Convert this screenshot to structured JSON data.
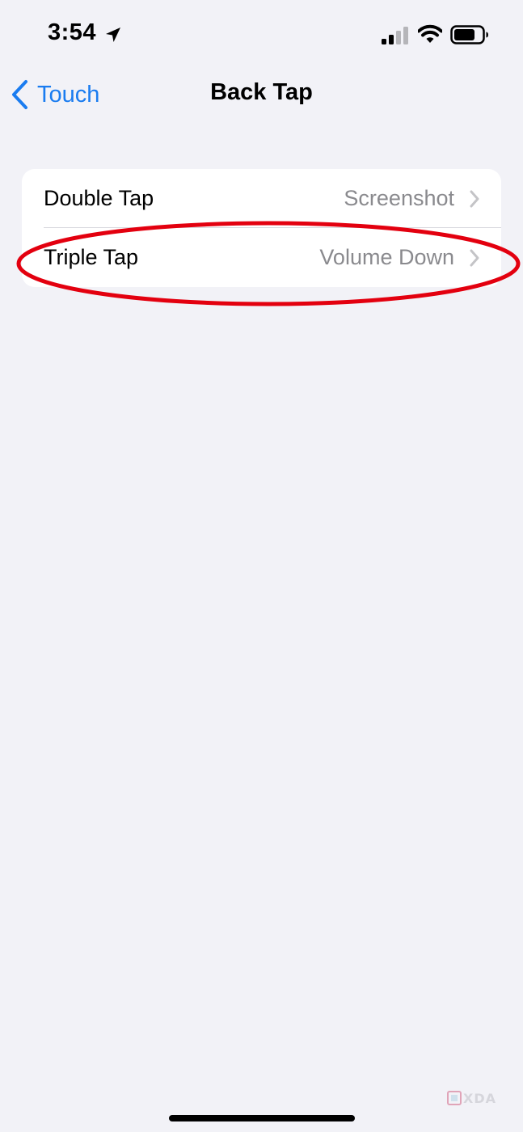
{
  "status_bar": {
    "time": "3:54",
    "icons": [
      "location-arrow-icon",
      "cellular-signal-icon",
      "wifi-icon",
      "battery-icon"
    ]
  },
  "nav": {
    "back_label": "Touch",
    "title": "Back Tap"
  },
  "settings": {
    "rows": [
      {
        "label": "Double Tap",
        "value": "Screenshot"
      },
      {
        "label": "Triple Tap",
        "value": "Volume Down"
      }
    ]
  },
  "watermark": {
    "text": "XDA"
  },
  "colors": {
    "background": "#f2f2f7",
    "accent": "#1a7cf0",
    "secondary_text": "#8a8a8e",
    "annotation_red": "#e3000f"
  }
}
